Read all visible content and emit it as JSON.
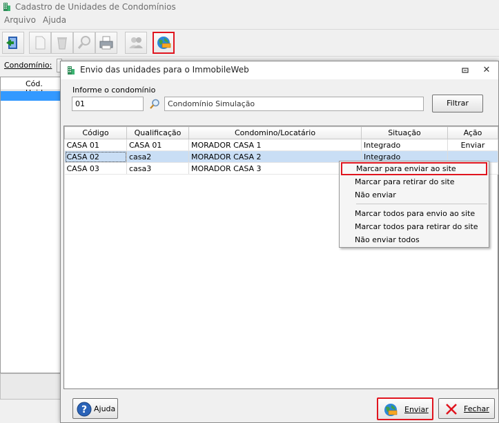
{
  "app": {
    "title": "Cadastro de Unidades de Condomínios",
    "menu": [
      "Arquivo",
      "Ajuda"
    ],
    "condominio_label": "Condomínio:",
    "list_header": "Cód. Unid"
  },
  "dialog": {
    "title": "Envio das unidades para o ImmobileWeb",
    "filter_label": "Informe o condomínio",
    "code_value": "01",
    "name_value": "Condomínio Simulação",
    "filter_button": "Filtrar",
    "columns": [
      "Código",
      "Qualificação",
      "Condomino/Locatário",
      "Situação",
      "Ação"
    ],
    "rows": [
      [
        "CASA 01",
        "CASA 01",
        "MORADOR CASA 1",
        "Integrado",
        "Enviar"
      ],
      [
        "CASA 02",
        "casa2",
        "MORADOR CASA 2",
        "Integrado",
        ""
      ],
      [
        "CASA 03",
        "casa3",
        "MORADOR CASA 3",
        "",
        ""
      ]
    ],
    "selected_row": 1,
    "context_menu": {
      "group1": [
        "Marcar para enviar ao site",
        "Marcar para retirar do site",
        "Não enviar"
      ],
      "group2": [
        "Marcar todos para envio ao site",
        "Marcar todos para retirar do site",
        "Não enviar todos"
      ]
    },
    "buttons": {
      "help": "Ajuda",
      "send": "Enviar",
      "close": "Fechar"
    }
  },
  "colors": {
    "highlight_red": "#e0141e",
    "selection_blue": "#c9def5",
    "list_selection": "#3399ff"
  }
}
